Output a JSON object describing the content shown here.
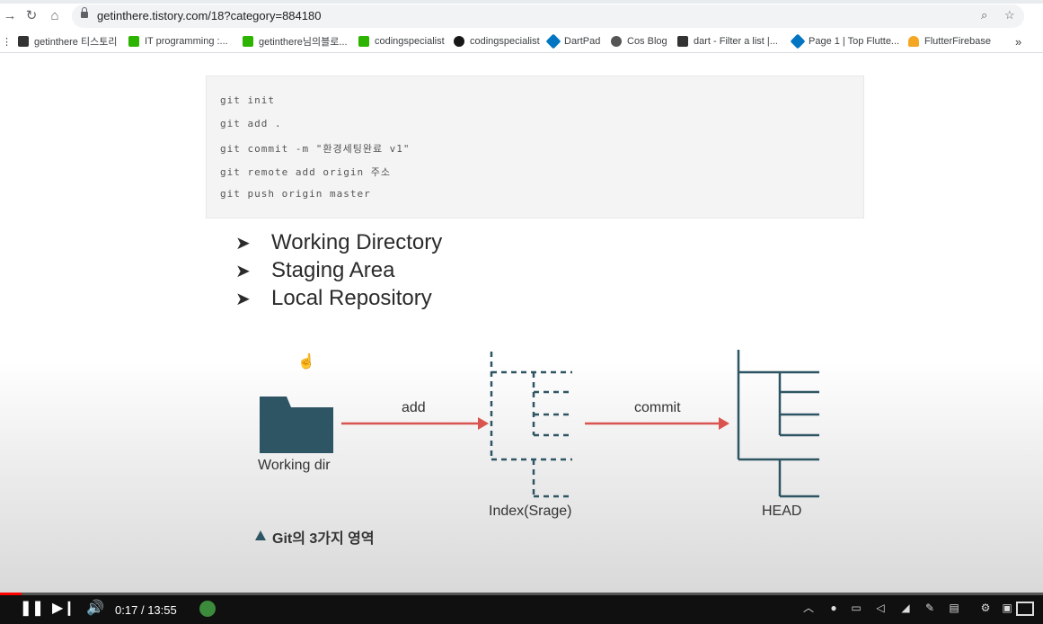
{
  "browser": {
    "url": "getinthere.tistory.com/18?category=884180",
    "bookmarks": [
      {
        "label": "getinthere 티스토리",
        "color": "#333333"
      },
      {
        "label": "IT programming :...",
        "color": "#2db400"
      },
      {
        "label": "getinthere님의블로...",
        "color": "#2db400"
      },
      {
        "label": "codingspecialist",
        "color": "#2db400"
      },
      {
        "label": "codingspecialist",
        "color": "#181717"
      },
      {
        "label": "DartPad",
        "color": "#0175c2"
      },
      {
        "label": "Cos Blog",
        "color": "#555555"
      },
      {
        "label": "dart - Filter a list |...",
        "color": "#333333"
      },
      {
        "label": "Page 1 | Top Flutte...",
        "color": "#0175c2"
      },
      {
        "label": "FlutterFirebase",
        "color": "#f5a623"
      }
    ],
    "more_label": "»"
  },
  "code_block": {
    "lines": [
      "git init",
      "git add .",
      "git commit -m \"환경세팅완료 v1\"",
      "git remote add origin 주소",
      "git push origin master"
    ]
  },
  "bullets": [
    "Working Directory",
    "Staging Area",
    "Local Repository"
  ],
  "diagram": {
    "working_dir_label": "Working dir",
    "add_label": "add",
    "commit_label": "commit",
    "index_label": "Index(Srage)",
    "head_label": "HEAD",
    "caption": "Git의 3가지 영역",
    "folder_color": "#2e5563",
    "arrow_color": "#d9534f"
  },
  "player": {
    "time_current": "0:17",
    "time_total": "13:55",
    "time_separator": "/",
    "progress": 0.0204
  }
}
